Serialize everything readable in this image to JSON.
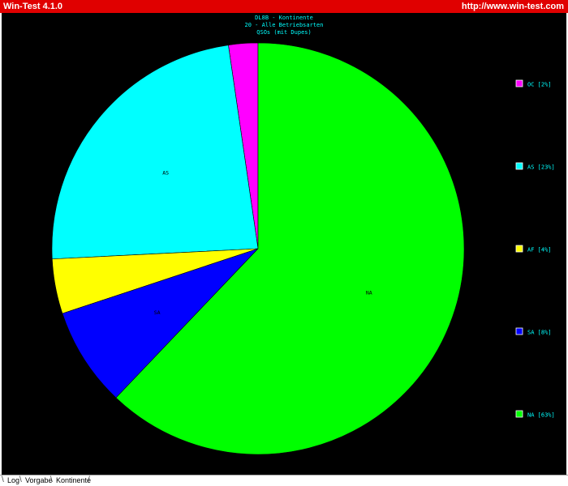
{
  "window": {
    "title": "Win-Test 4.1.0",
    "url": "http://www.win-test.com"
  },
  "tabs": [
    {
      "label": "Log",
      "active": false
    },
    {
      "label": "Vorgabe",
      "active": false
    },
    {
      "label": "Kontinente",
      "active": true
    }
  ],
  "colors": {
    "titlebar": "#e00000",
    "background": "#000000",
    "title_text": "#00ffff",
    "legend_text": "#00ffff"
  },
  "chart_data": {
    "type": "pie",
    "title_lines": [
      "DL8B - Kontinente",
      "20 - Alle Betriebsarten",
      "QSOs (mit Dupes)"
    ],
    "slices": [
      {
        "label": "OC",
        "legend": "OC [2%]",
        "value": 2.3,
        "color": "#ff00ff",
        "show_label": false
      },
      {
        "label": "AS",
        "legend": "AS [23%]",
        "value": 23.5,
        "color": "#00ffff",
        "show_label": true
      },
      {
        "label": "AF",
        "legend": "AF [4%]",
        "value": 4.3,
        "color": "#ffff00",
        "show_label": false
      },
      {
        "label": "SA",
        "legend": "SA [8%]",
        "value": 7.8,
        "color": "#0000ff",
        "show_label": true
      },
      {
        "label": "NA",
        "legend": "NA [63%]",
        "value": 62.1,
        "color": "#00ff00",
        "show_label": true
      }
    ],
    "start": "top",
    "direction": "counterclockwise",
    "legend_position": "right"
  }
}
